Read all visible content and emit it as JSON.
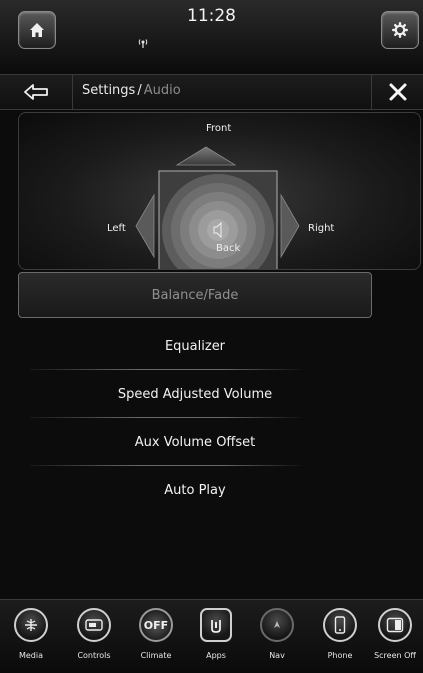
{
  "status": {
    "time": "11:28",
    "wireless_icon": "wireless-signal-icon"
  },
  "topbar": {
    "home_icon": "home-icon",
    "settings_icon": "gear-icon"
  },
  "header": {
    "back_icon": "back-arrow-icon",
    "parent": "Settings",
    "separator": "/",
    "current": "Audio",
    "close_icon": "close-icon"
  },
  "balance": {
    "front": "Front",
    "back": "Back",
    "left": "Left",
    "right": "Right"
  },
  "menu": {
    "items": [
      {
        "label": "Balance/Fade",
        "active": true
      },
      {
        "label": "Equalizer"
      },
      {
        "label": "Speed Adjusted Volume"
      },
      {
        "label": "Aux Volume Offset"
      },
      {
        "label": "Auto Play"
      }
    ]
  },
  "dock": {
    "items": [
      {
        "label": "Media",
        "icon": "media-icon"
      },
      {
        "label": "Controls",
        "icon": "controls-icon"
      },
      {
        "label": "Climate",
        "icon": "climate-icon",
        "badge": "OFF"
      },
      {
        "label": "Apps",
        "icon": "apps-icon"
      },
      {
        "label": "Nav",
        "icon": "nav-icon"
      },
      {
        "label": "Phone",
        "icon": "phone-icon"
      },
      {
        "label": "Screen Off",
        "icon": "screen-off-icon"
      }
    ]
  }
}
